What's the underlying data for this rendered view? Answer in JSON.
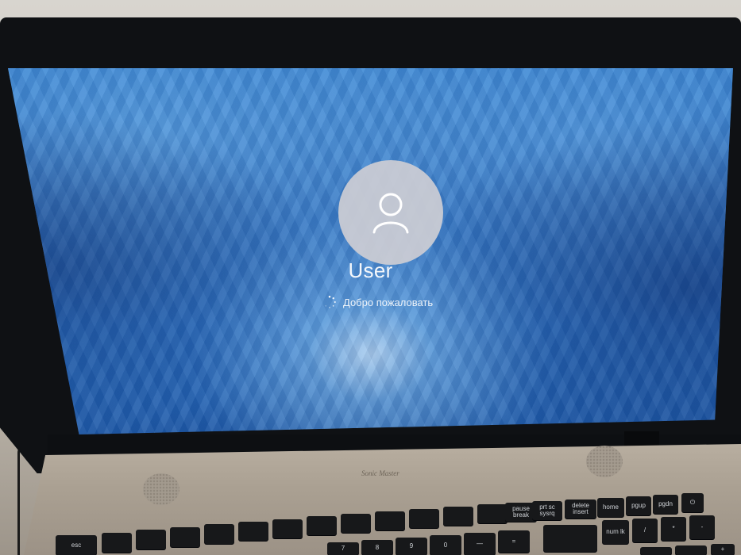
{
  "login_screen": {
    "username": "User",
    "status_text": "Добро пожаловать",
    "avatar_icon": "user-avatar-icon",
    "spinner_icon": "loading-spinner-icon"
  },
  "laptop": {
    "brand_label": "Sonic Master"
  },
  "keyboard": {
    "keys": [
      "esc",
      "pause break",
      "prt sc sysrq",
      "delete insert",
      "home",
      "pgup",
      "pgdn",
      "num lk",
      "9",
      "0",
      "8",
      "7",
      "—",
      "+",
      "=",
      "*",
      "-"
    ]
  },
  "colors": {
    "wallpaper_blue": "#2a6cc0",
    "text_white": "#f4f7fb",
    "avatar_gray": "#cdcdd4",
    "bezel": "#0f1114",
    "deck": "#aaa092"
  }
}
